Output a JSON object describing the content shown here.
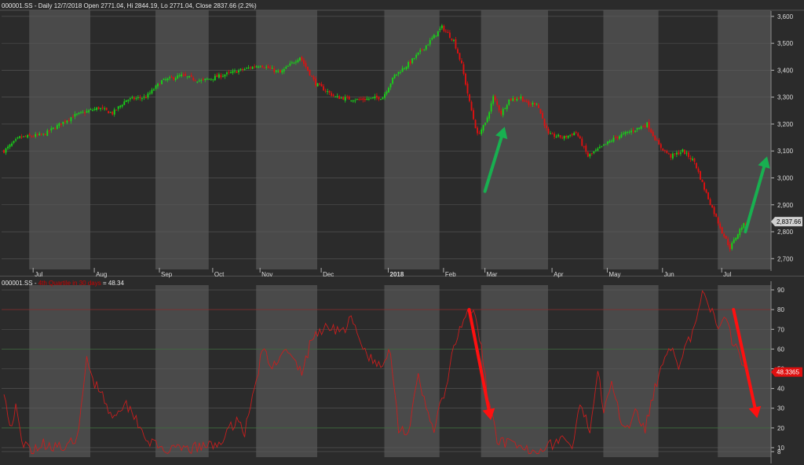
{
  "colors": {
    "up": "#19d219",
    "down": "#e01010",
    "indicator": "#c81e1e",
    "background_dark": "#2b2b2b",
    "background_light": "#4a4a4a",
    "last_badge_bg": "#d0d0d0",
    "indicator_badge_bg": "#e01010"
  },
  "header_top": {
    "symbol": "000001.SS",
    "text": "Daily 12/7/2018 Open 2771.04, Hi 2844.19, Lo 2771.04, Close 2837.66 (2.2%)"
  },
  "header_bottom": {
    "symbol": "000001.SS",
    "indicator_label": "4th Quartile in 30 days",
    "indicator_value": "48.34"
  },
  "chart_data": [
    {
      "type": "candlestick",
      "series_name": "000001.SS",
      "ylim": [
        2660,
        3620
      ],
      "yticks": [
        "3,600",
        "3,500",
        "3,400",
        "3,300",
        "3,200",
        "3,100",
        "3,000",
        "2,900",
        "2,800",
        "2,700"
      ],
      "ytick_values": [
        3600,
        3500,
        3400,
        3300,
        3200,
        3100,
        3000,
        2900,
        2800,
        2700
      ],
      "x_labels": [
        "Jul",
        "Aug",
        "Sep",
        "Oct",
        "Nov",
        "Dec",
        "2018",
        "Feb",
        "Mar",
        "Apr",
        "May",
        "Jun",
        "Jul"
      ],
      "x_label_day_index": [
        16,
        47,
        80,
        107,
        131,
        162,
        196,
        224,
        245,
        279,
        307,
        335,
        365
      ],
      "total_days": 390,
      "last_value_label": "2,837.66",
      "last_value": 2837.66,
      "anchors": [
        [
          0,
          3100
        ],
        [
          8,
          3150
        ],
        [
          20,
          3160
        ],
        [
          35,
          3230
        ],
        [
          48,
          3260
        ],
        [
          55,
          3240
        ],
        [
          62,
          3290
        ],
        [
          72,
          3300
        ],
        [
          80,
          3360
        ],
        [
          90,
          3380
        ],
        [
          100,
          3360
        ],
        [
          110,
          3380
        ],
        [
          120,
          3400
        ],
        [
          130,
          3420
        ],
        [
          140,
          3390
        ],
        [
          150,
          3450
        ],
        [
          158,
          3350
        ],
        [
          168,
          3300
        ],
        [
          180,
          3290
        ],
        [
          192,
          3300
        ],
        [
          198,
          3380
        ],
        [
          206,
          3430
        ],
        [
          215,
          3500
        ],
        [
          222,
          3560
        ],
        [
          228,
          3510
        ],
        [
          232,
          3420
        ],
        [
          236,
          3280
        ],
        [
          238,
          3220
        ],
        [
          240,
          3160
        ],
        [
          244,
          3200
        ],
        [
          248,
          3300
        ],
        [
          252,
          3240
        ],
        [
          256,
          3290
        ],
        [
          262,
          3300
        ],
        [
          266,
          3270
        ],
        [
          270,
          3280
        ],
        [
          276,
          3160
        ],
        [
          284,
          3150
        ],
        [
          290,
          3170
        ],
        [
          296,
          3080
        ],
        [
          302,
          3110
        ],
        [
          310,
          3150
        ],
        [
          320,
          3180
        ],
        [
          326,
          3200
        ],
        [
          332,
          3120
        ],
        [
          338,
          3080
        ],
        [
          344,
          3100
        ],
        [
          350,
          3060
        ],
        [
          355,
          2960
        ],
        [
          360,
          2870
        ],
        [
          364,
          2800
        ],
        [
          368,
          2740
        ],
        [
          371,
          2780
        ],
        [
          374,
          2820
        ],
        [
          377,
          2835
        ]
      ],
      "arrows": [
        {
          "color": "green",
          "from": [
            245,
            2950
          ],
          "to": [
            255,
            3190
          ]
        },
        {
          "color": "green",
          "from": [
            377,
            2800
          ],
          "to": [
            388,
            3080
          ]
        }
      ]
    },
    {
      "type": "line",
      "series_name": "000001.SS",
      "ylim": [
        6,
        92
      ],
      "yticks": [
        "90",
        "80",
        "70",
        "60",
        "50",
        "40",
        "30",
        "20",
        "10",
        "8"
      ],
      "ytick_values": [
        90,
        80,
        70,
        60,
        50,
        40,
        30,
        20,
        10,
        8
      ],
      "hlines": [
        80,
        60,
        20
      ],
      "last_value_label": "48.3365",
      "last_value": 48.34,
      "anchors": [
        [
          0,
          40
        ],
        [
          3,
          20
        ],
        [
          6,
          30
        ],
        [
          9,
          12
        ],
        [
          14,
          9
        ],
        [
          20,
          12
        ],
        [
          26,
          11
        ],
        [
          32,
          9
        ],
        [
          38,
          18
        ],
        [
          42,
          55
        ],
        [
          46,
          43
        ],
        [
          50,
          38
        ],
        [
          54,
          26
        ],
        [
          58,
          30
        ],
        [
          62,
          32
        ],
        [
          66,
          27
        ],
        [
          72,
          15
        ],
        [
          78,
          10
        ],
        [
          84,
          8
        ],
        [
          90,
          9
        ],
        [
          98,
          10
        ],
        [
          106,
          11
        ],
        [
          112,
          15
        ],
        [
          118,
          25
        ],
        [
          122,
          18
        ],
        [
          126,
          35
        ],
        [
          131,
          60
        ],
        [
          136,
          50
        ],
        [
          141,
          60
        ],
        [
          146,
          55
        ],
        [
          151,
          48
        ],
        [
          156,
          65
        ],
        [
          161,
          70
        ],
        [
          166,
          72
        ],
        [
          171,
          68
        ],
        [
          176,
          75
        ],
        [
          181,
          62
        ],
        [
          186,
          55
        ],
        [
          191,
          50
        ],
        [
          196,
          60
        ],
        [
          200,
          20
        ],
        [
          205,
          18
        ],
        [
          210,
          45
        ],
        [
          214,
          30
        ],
        [
          218,
          20
        ],
        [
          224,
          40
        ],
        [
          228,
          60
        ],
        [
          232,
          72
        ],
        [
          236,
          80
        ],
        [
          239,
          75
        ],
        [
          242,
          60
        ],
        [
          246,
          30
        ],
        [
          250,
          15
        ],
        [
          255,
          12
        ],
        [
          260,
          10
        ],
        [
          266,
          8
        ],
        [
          272,
          10
        ],
        [
          278,
          12
        ],
        [
          283,
          15
        ],
        [
          288,
          10
        ],
        [
          292,
          30
        ],
        [
          297,
          20
        ],
        [
          301,
          50
        ],
        [
          304,
          30
        ],
        [
          308,
          45
        ],
        [
          312,
          25
        ],
        [
          316,
          20
        ],
        [
          320,
          30
        ],
        [
          325,
          20
        ],
        [
          330,
          40
        ],
        [
          334,
          55
        ],
        [
          338,
          62
        ],
        [
          342,
          48
        ],
        [
          346,
          62
        ],
        [
          350,
          70
        ],
        [
          354,
          88
        ],
        [
          358,
          80
        ],
        [
          362,
          72
        ],
        [
          366,
          78
        ],
        [
          369,
          65
        ],
        [
          372,
          60
        ],
        [
          375,
          52
        ],
        [
          377,
          48.34
        ]
      ],
      "arrows": [
        {
          "color": "red",
          "from": [
            237,
            80
          ],
          "to": [
            248,
            24
          ]
        },
        {
          "color": "red",
          "from": [
            371,
            80
          ],
          "to": [
            383,
            25
          ]
        }
      ]
    }
  ]
}
